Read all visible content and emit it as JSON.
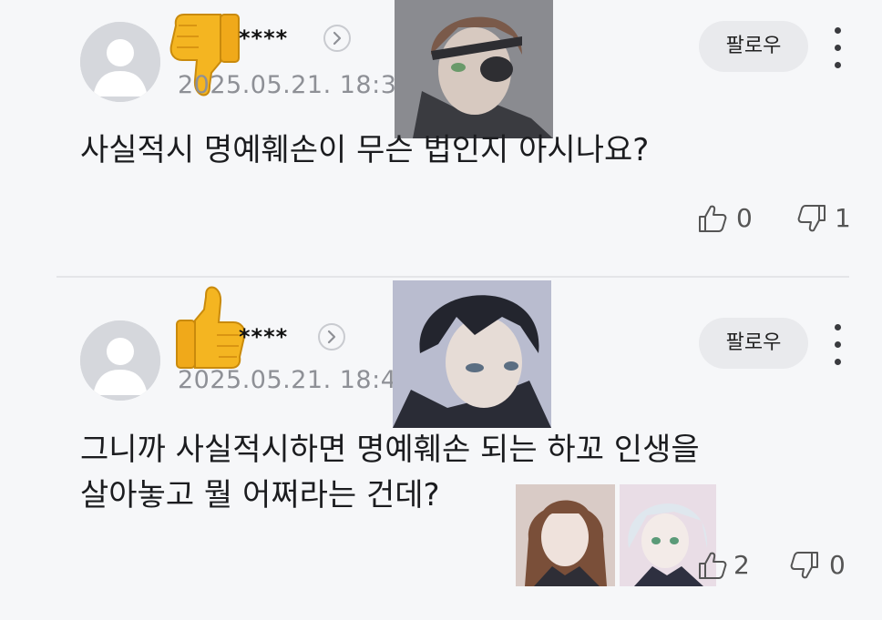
{
  "comments": [
    {
      "username": "****",
      "date": "2025.05.21. 18:33",
      "text_lines": [
        "사실적시 명예훼손이 무슨 법인지 아시나요?"
      ],
      "follow_label": "팔로우",
      "likes": "0",
      "dislikes": "1",
      "sticker": "thumbs-down"
    },
    {
      "username": "****",
      "date": "2025.05.21. 18:48",
      "text_lines": [
        "그니까 사실적시하면 명예훼손 되는 하꼬 인생을",
        "살아놓고 뭘 어쩌라는 건데?"
      ],
      "follow_label": "팔로우",
      "likes": "2",
      "dislikes": "0",
      "sticker": "thumbs-up"
    }
  ],
  "icons": {
    "like": "thumbs-up-outline-icon",
    "dislike": "thumbs-down-outline-icon",
    "more": "vertical-ellipsis-icon",
    "chevron": "chevron-right-icon"
  },
  "colors": {
    "background": "#f6f7f9",
    "follow_button_bg": "#e9eaed",
    "meta_text": "#8e9096",
    "emoji_yellow": "#f4b521"
  }
}
